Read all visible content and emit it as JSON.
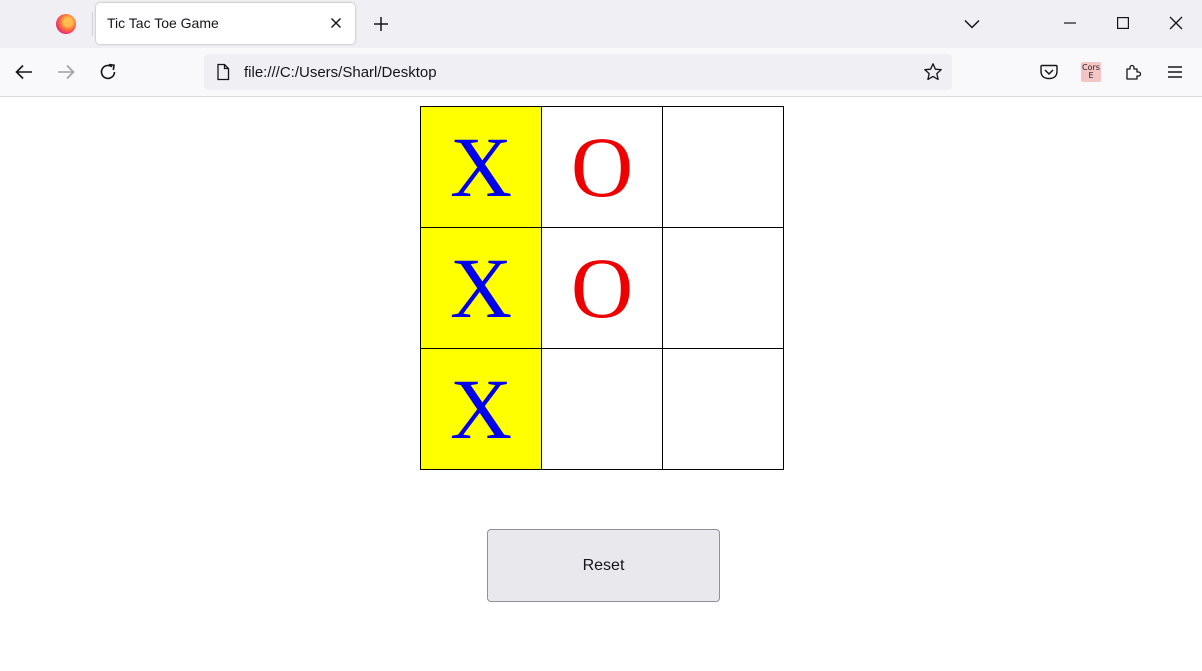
{
  "browser": {
    "tab_title": "Tic Tac Toe Game",
    "url": "file:///C:/Users/Sharl/Desktop",
    "extension_badge": [
      "Cors",
      "E"
    ],
    "icons": [
      "firefox-logo",
      "close-icon",
      "plus-icon",
      "chevron-down-icon",
      "minimize-icon",
      "maximize-icon",
      "close-window-icon",
      "back-arrow-icon",
      "forward-arrow-icon",
      "reload-icon",
      "page-icon",
      "star-icon",
      "pocket-icon",
      "puzzle-icon",
      "hamburger-menu-icon"
    ]
  },
  "game": {
    "board": [
      [
        "X",
        "O",
        ""
      ],
      [
        "X",
        "O",
        ""
      ],
      [
        "X",
        "",
        ""
      ]
    ],
    "winning_cells": [
      [
        0,
        0
      ],
      [
        1,
        0
      ],
      [
        2,
        0
      ]
    ],
    "colors": {
      "x": "#0000ee",
      "o": "#ee0000",
      "win_highlight": "#ffff00"
    },
    "reset_label": "Reset"
  }
}
